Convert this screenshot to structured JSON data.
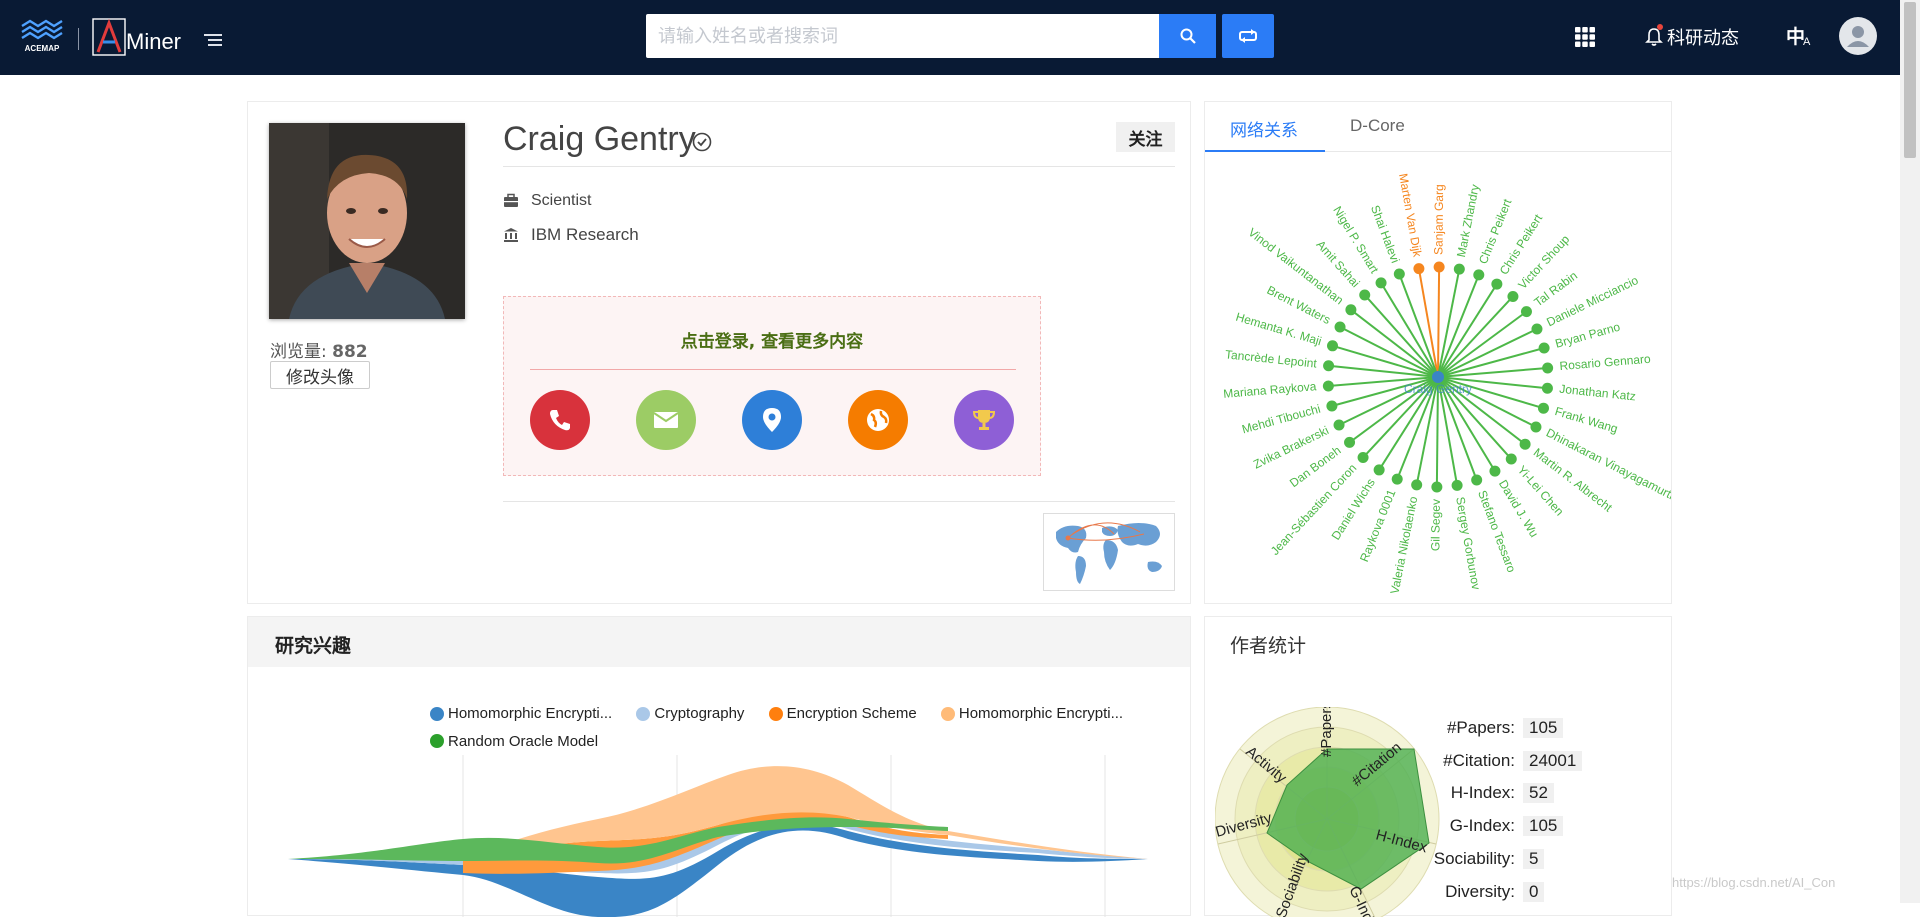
{
  "header": {
    "brand_left": "ACEMAP",
    "brand_right": "Miner",
    "search_placeholder": "请输入姓名或者搜索词",
    "news_label": "科研动态",
    "lang_zh": "中",
    "lang_en": "A"
  },
  "profile": {
    "name": "Craig Gentry",
    "follow_label": "关注",
    "title": "Scientist",
    "organization": "IBM Research",
    "views_label": "浏览量:",
    "views_count": "882",
    "edit_avatar_label": "修改头像",
    "login_prompt": "点击登录, 查看更多内容",
    "contact_icons": [
      "phone-icon",
      "email-icon",
      "location-icon",
      "homepage-icon",
      "award-icon"
    ],
    "contact_colors": [
      "#d8323c",
      "#9ccc65",
      "#2e7fd8",
      "#f57c00",
      "#8e5fd6"
    ]
  },
  "network": {
    "tabs": [
      "网络关系",
      "D-Core"
    ],
    "center_label": "Craig Gentry",
    "coauthors": [
      {
        "name": "Marten Van Dijk",
        "highlight": true
      },
      {
        "name": "Sanjam Garg",
        "highlight": true
      },
      {
        "name": "Mark Zhandry",
        "highlight": false
      },
      {
        "name": "Chris Peikert",
        "highlight": false
      },
      {
        "name": "Chris Peikert",
        "highlight": false
      },
      {
        "name": "Victor Shoup",
        "highlight": false
      },
      {
        "name": "Tal Rabin",
        "highlight": false
      },
      {
        "name": "Daniele Micciancio",
        "highlight": false
      },
      {
        "name": "Bryan Parno",
        "highlight": false
      },
      {
        "name": "Rosario Gennaro",
        "highlight": false
      },
      {
        "name": "Jonathan Katz",
        "highlight": false
      },
      {
        "name": "Frank Wang",
        "highlight": false
      },
      {
        "name": "Dhinakaran Vinayagamurthy",
        "highlight": false
      },
      {
        "name": "Martin R. Albrecht",
        "highlight": false
      },
      {
        "name": "Yi-Lei Chen",
        "highlight": false
      },
      {
        "name": "David J. Wu",
        "highlight": false
      },
      {
        "name": "Stefano Tessaro",
        "highlight": false
      },
      {
        "name": "Sergey Gorbunov",
        "highlight": false
      },
      {
        "name": "Gil Segev",
        "highlight": false
      },
      {
        "name": "Valeria Nikolaenko",
        "highlight": false
      },
      {
        "name": "Raykova 0001",
        "highlight": false
      },
      {
        "name": "Daniel Wichs",
        "highlight": false
      },
      {
        "name": "Jean-Sébastien Coron",
        "highlight": false
      },
      {
        "name": "Dan Boneh",
        "highlight": false
      },
      {
        "name": "Zvika Brakerski",
        "highlight": false
      },
      {
        "name": "Mehdi Tibouchi",
        "highlight": false
      },
      {
        "name": "Mariana Raykova",
        "highlight": false
      },
      {
        "name": "Tancrède Lepoint",
        "highlight": false
      },
      {
        "name": "Hemanta K. Maji",
        "highlight": false
      },
      {
        "name": "Brent Waters",
        "highlight": false
      },
      {
        "name": "Vinod Vaikuntanathan",
        "highlight": false
      },
      {
        "name": "Amit Sahai",
        "highlight": false
      },
      {
        "name": "Nigel P. Smart",
        "highlight": false
      },
      {
        "name": "Shai Halevi",
        "highlight": false
      }
    ]
  },
  "interests": {
    "title": "研究兴趣",
    "legend": [
      {
        "name": "Homomorphic Encrypti...",
        "color": "#3a85c6"
      },
      {
        "name": "Cryptography",
        "color": "#aac8e8"
      },
      {
        "name": "Encryption Scheme",
        "color": "#ff7f0e"
      },
      {
        "name": "Homomorphic Encrypti...",
        "color": "#ffbb78"
      },
      {
        "name": "Random Oracle Model",
        "color": "#2ca02c"
      }
    ]
  },
  "stats": {
    "title": "作者统计",
    "rows": [
      {
        "label": "#Papers:",
        "value": "105"
      },
      {
        "label": "#Citation:",
        "value": "24001"
      },
      {
        "label": "H-Index:",
        "value": "52"
      },
      {
        "label": "G-Index:",
        "value": "105"
      },
      {
        "label": "Sociability:",
        "value": "5"
      },
      {
        "label": "Diversity:",
        "value": "0"
      }
    ],
    "radar_axes": [
      "#Papers",
      "#Citation",
      "H-Index",
      "G-Index",
      "Sociability",
      "Diversity",
      "Activity"
    ]
  },
  "watermark": "https://blog.csdn.net/AI_Con"
}
